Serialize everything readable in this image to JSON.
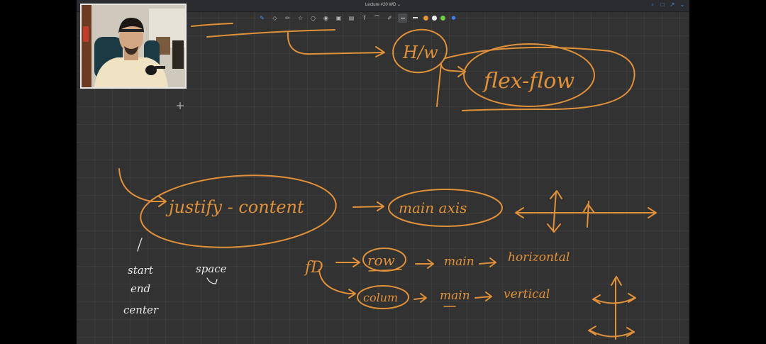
{
  "window": {
    "title": "Lecture #20 WD ⌄"
  },
  "toolbar": {
    "tools": [
      {
        "name": "pen-tool",
        "glyph": "✎"
      },
      {
        "name": "eraser-tool",
        "glyph": "◇"
      },
      {
        "name": "highlighter-tool",
        "glyph": "✏"
      },
      {
        "name": "shapes-tool",
        "glyph": "☆"
      },
      {
        "name": "lasso-tool",
        "glyph": "○"
      },
      {
        "name": "text-tool",
        "glyph": "◉"
      },
      {
        "name": "image-tool",
        "glyph": "▣"
      },
      {
        "name": "camera-tool",
        "glyph": "▤"
      },
      {
        "name": "textbox-tool",
        "glyph": "T"
      },
      {
        "name": "link-tool",
        "glyph": "⌒"
      },
      {
        "name": "pen-settings-tool",
        "glyph": "✐"
      }
    ],
    "colors": {
      "orange": "#e8943a",
      "white": "#f2f2f2",
      "green": "#6fcf3f",
      "blue": "#3d7ef5"
    }
  },
  "notes": {
    "hw": "H/w",
    "flex_flow": "flex-flow",
    "justify_content": "justify - content",
    "main_axis": "main  axis",
    "fd": "fD",
    "row": "row",
    "column": "colum",
    "main1": "main",
    "main2": "main",
    "horizontal": "horizontal",
    "vertical": "vertical",
    "start": "start",
    "end": "end",
    "center": "center",
    "space": "space"
  },
  "accent": "#e0913a"
}
